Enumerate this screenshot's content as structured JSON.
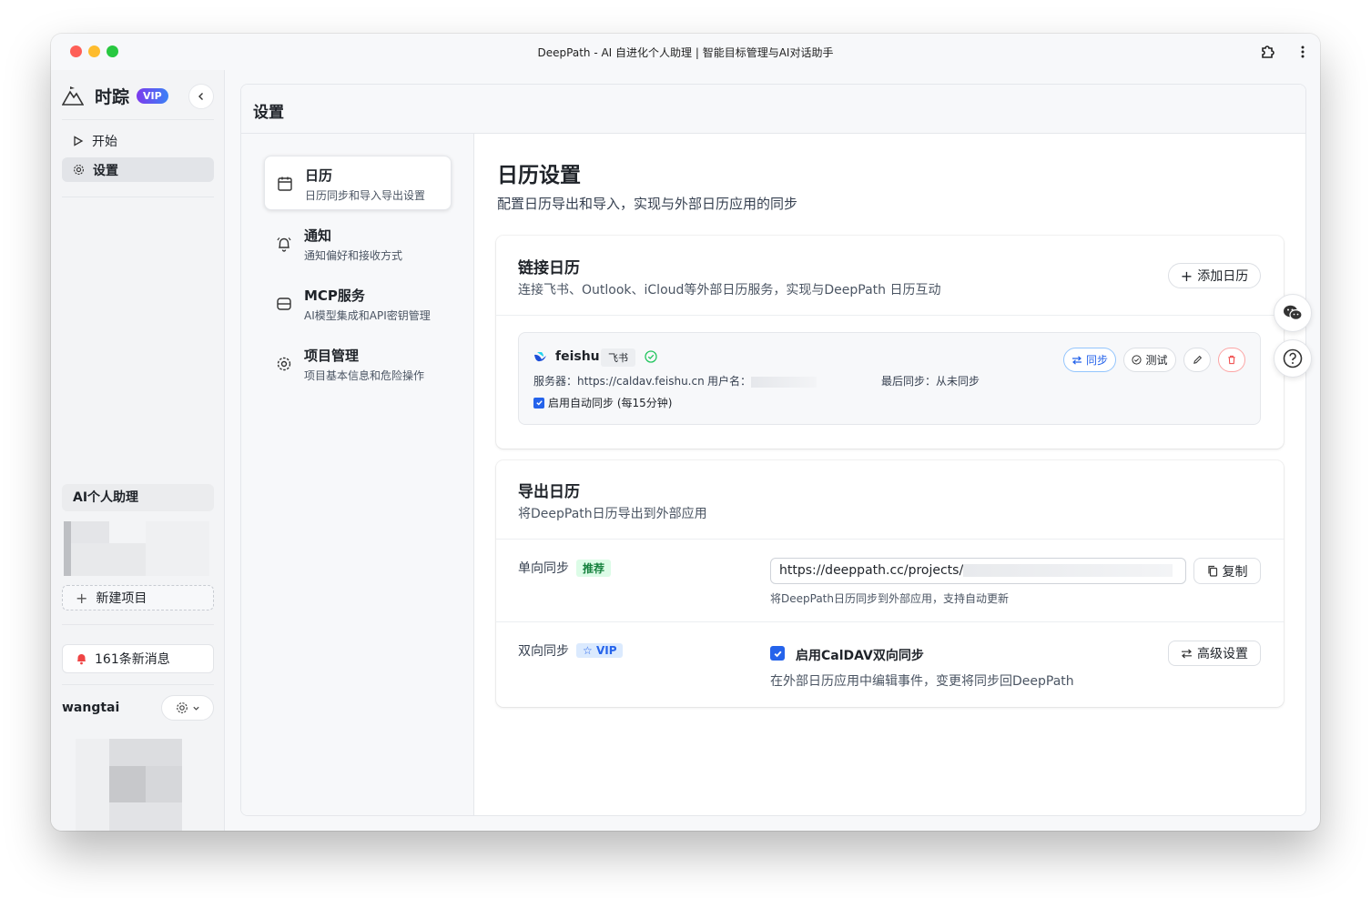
{
  "window": {
    "title": "DeepPath - AI 自进化个人助理 | 智能目标管理与AI对话助手"
  },
  "sidebar": {
    "brand": "时踪",
    "vip": "VIP",
    "nav": [
      {
        "label": "开始",
        "icon": "play-icon"
      },
      {
        "label": "设置",
        "icon": "gear-icon"
      }
    ],
    "ai_section": "AI个人助理",
    "new_project": "新建项目",
    "messages": "161条新消息",
    "user": "wangtai"
  },
  "main": {
    "title": "设置",
    "settings_nav": [
      {
        "title": "日历",
        "sub": "日历同步和导入导出设置",
        "icon": "calendar-icon"
      },
      {
        "title": "通知",
        "sub": "通知偏好和接收方式",
        "icon": "bell-icon"
      },
      {
        "title": "MCP服务",
        "sub": "AI模型集成和API密钥管理",
        "icon": "server-icon"
      },
      {
        "title": "项目管理",
        "sub": "项目基本信息和危险操作",
        "icon": "settings-cog-icon"
      }
    ],
    "page": {
      "title": "日历设置",
      "desc": "配置日历导出和导入，实现与外部日历应用的同步"
    },
    "linked": {
      "title": "链接日历",
      "desc": "连接飞书、Outlook、iCloud等外部日历服务，实现与DeepPath 日历互动",
      "add_button": "添加日历",
      "calendar": {
        "name": "feishu",
        "tag": "飞书",
        "server_label": "服务器：",
        "server": "https://caldav.feishu.cn",
        "user_label": "用户名：",
        "last_sync_label": "最后同步：",
        "last_sync": "从未同步",
        "auto_sync": "启用自动同步 (每15分钟)",
        "sync_button": "同步",
        "test_button": "测试"
      }
    },
    "export": {
      "title": "导出日历",
      "desc": "将DeepPath日历导出到外部应用",
      "oneway_label": "单向同步",
      "oneway_tag": "推荐",
      "url": "https://deeppath.cc/projects/",
      "copy_button": "复制",
      "url_hint": "将DeepPath日历同步到外部应用，支持自动更新",
      "twoway_label": "双向同步",
      "twoway_tag": "VIP",
      "caldav_label": "启用CalDAV双向同步",
      "advanced_button": "高级设置",
      "caldav_hint": "在外部日历应用中编辑事件，变更将同步回DeepPath"
    }
  },
  "colors": {
    "accent": "#2563eb",
    "danger": "#ef4444",
    "success": "#22c55e",
    "vip_gradient": "#7c3aed"
  }
}
